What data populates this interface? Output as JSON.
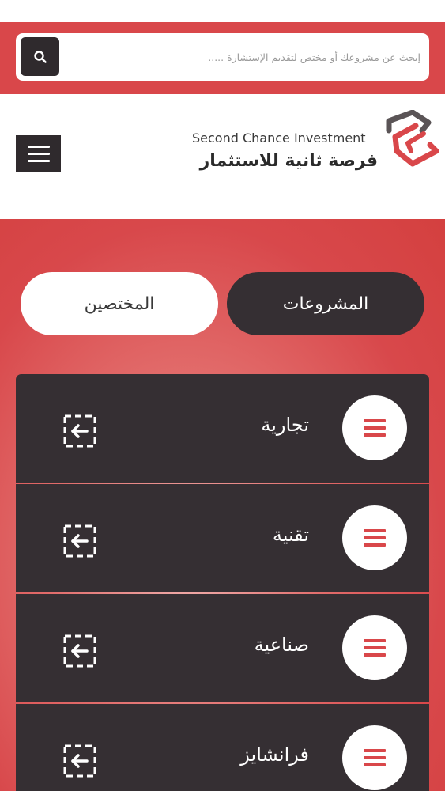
{
  "colors": {
    "brand_red": "#d9474a",
    "dark": "#352f33",
    "white": "#ffffff"
  },
  "search": {
    "placeholder": "إبحث عن مشروعك أو مختص لتقديم الإستشارة .....",
    "button_icon": "search-icon"
  },
  "header": {
    "brand_en": "Second Chance Investment",
    "brand_ar": "فرصة ثانية للاستثمار",
    "logo_icon": "second-chance-logo",
    "menu_icon": "hamburger-menu-icon"
  },
  "tabs": [
    {
      "label": "المشروعات",
      "active": true
    },
    {
      "label": "المختصين",
      "active": false
    }
  ],
  "categories": [
    {
      "label": "تجارية",
      "icon": "list-icon",
      "action_icon": "enter-icon"
    },
    {
      "label": "تقنية",
      "icon": "list-icon",
      "action_icon": "enter-icon"
    },
    {
      "label": "صناعية",
      "icon": "list-icon",
      "action_icon": "enter-icon"
    },
    {
      "label": "فرانشايز",
      "icon": "list-icon",
      "action_icon": "enter-icon"
    }
  ]
}
